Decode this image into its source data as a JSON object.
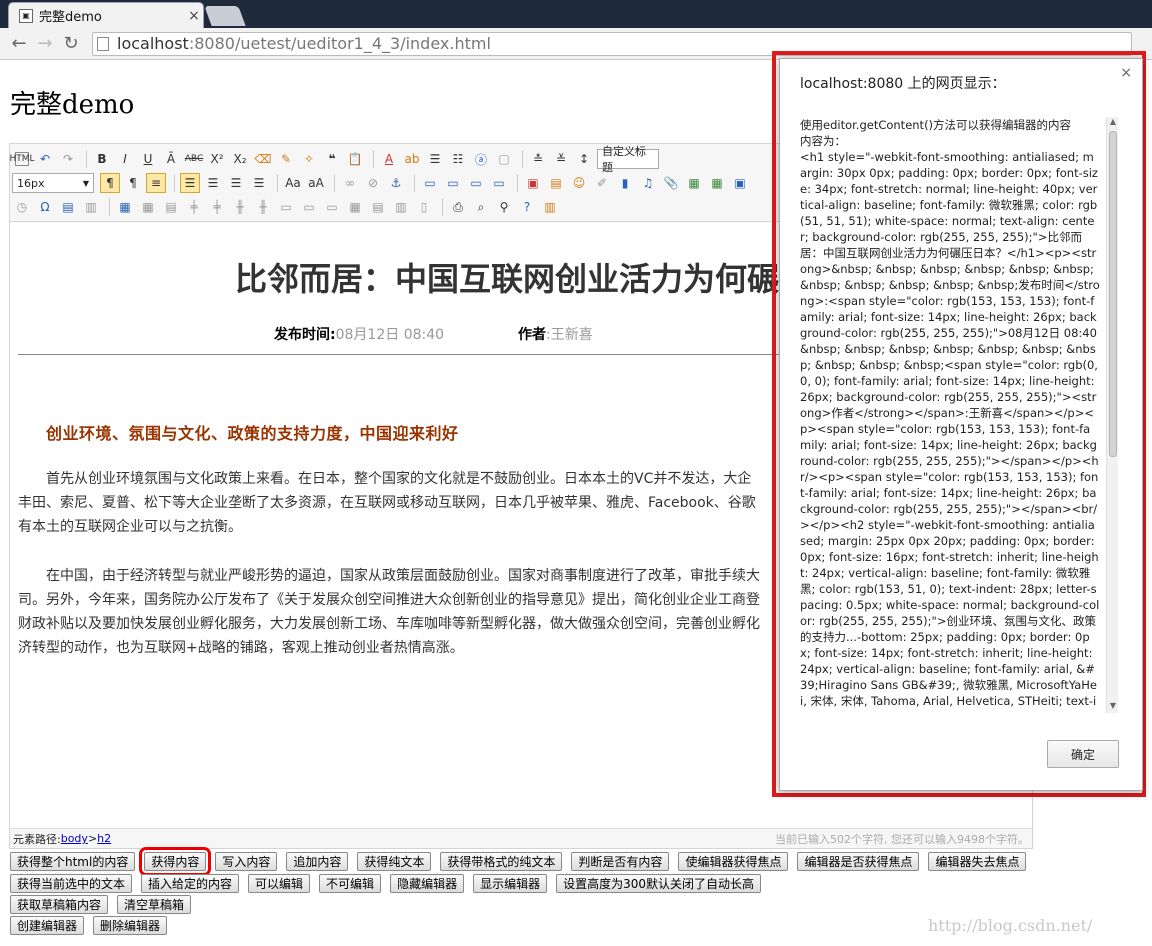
{
  "browser": {
    "tab_title": "完整demo",
    "tab_close": "×",
    "url_host": "localhost",
    "url_rest": ":8080/uetest/ueditor1_4_3/index.html"
  },
  "page": {
    "title": "完整demo"
  },
  "toolbar": {
    "font_size": "16px",
    "paragraph_format": "自定义标题"
  },
  "article": {
    "title": "比邻而居：中国互联网创业活力为何碾压",
    "time_label": "发布时间:",
    "time_value": "08月12日 08:40",
    "author_label": "作者",
    "author_value": ":王新喜",
    "heading": "创业环境、氛围与文化、政策的支持力度，中国迎来利好",
    "p1": [
      "首先从创业环境氛围与文化政策上来看。在日本，整个国家的文化就是不鼓励创业。日本本土的VC并不发达，大企",
      "丰田、索尼、夏普、松下等大企业垄断了太多资源，在互联网或移动互联网，日本几乎被苹果、雅虎、Facebook、谷歌",
      "有本土的互联网企业可以与之抗衡。"
    ],
    "p2": [
      "在中国，由于经济转型与就业严峻形势的逼迫，国家从政策层面鼓励创业。国家对商事制度进行了改革，审批手续大",
      "司。另外，今年来，国务院办公厅发布了《关于发展众创空间推进大众创新创业的指导意见》提出，简化创业企业工商登",
      "财政补贴以及要加快发展创业孵化服务，大力发展创新工场、车库咖啡等新型孵化器，做大做强众创空间，完善创业孵化",
      "济转型的动作，也为互联网+战略的铺路，客观上推动创业者热情高涨。"
    ]
  },
  "statusbar": {
    "path_label": "元素路径:",
    "path_body": "body",
    "path_sep": " > ",
    "path_h2": "h2",
    "count": "当前已输入502个字符, 您还可以输入9498个字符。"
  },
  "buttons": {
    "row1": [
      "获得整个html的内容",
      "获得内容",
      "写入内容",
      "追加内容",
      "获得纯文本",
      "获得带格式的纯文本",
      "判断是否有内容",
      "使编辑器获得焦点",
      "编辑器是否获得焦点",
      "编辑器失去焦点"
    ],
    "row2": [
      "获得当前选中的文本",
      "插入给定的内容",
      "可以编辑",
      "不可编辑",
      "隐藏编辑器",
      "显示编辑器",
      "设置高度为300默认关闭了自动长高"
    ],
    "row3": [
      "获取草稿箱内容",
      "清空草稿箱"
    ],
    "row4": [
      "创建编辑器",
      "删除编辑器"
    ]
  },
  "watermark": "http://blog.csdn.net/",
  "dialog": {
    "title": "localhost:8080 上的网页显示：",
    "close": "×",
    "ok": "确定",
    "body": "使用editor.getContent()方法可以获得编辑器的内容\n内容为：\n<h1 style=\"-webkit-font-smoothing: antialiased; margin: 30px 0px; padding: 0px; border: 0px; font-size: 34px; font-stretch: normal; line-height: 40px; vertical-align: baseline; font-family: 微软雅黑; color: rgb(51, 51, 51); white-space: normal; text-align: center; background-color: rgb(255, 255, 255);\">比邻而居：中国互联网创业活力为何碾压日本？</h1><p><strong>&nbsp; &nbsp; &nbsp; &nbsp; &nbsp; &nbsp; &nbsp; &nbsp; &nbsp; &nbsp; &nbsp;发布时间</strong>:<span style=\"color: rgb(153, 153, 153); font-family: arial; font-size: 14px; line-height: 26px; background-color: rgb(255, 255, 255);\">08月12日 08:40 &nbsp; &nbsp; &nbsp; &nbsp; &nbsp; &nbsp; &nbsp; &nbsp; &nbsp; &nbsp;<span style=\"color: rgb(0, 0, 0); font-family: arial; font-size: 14px; line-height: 26px; background-color: rgb(255, 255, 255);\"><strong>作者</strong></span>:王新喜</span></p><p><span style=\"color: rgb(153, 153, 153); font-family: arial; font-size: 14px; line-height: 26px; background-color: rgb(255, 255, 255);\"></span></p><hr/><p><span style=\"color: rgb(153, 153, 153); font-family: arial; font-size: 14px; line-height: 26px; background-color: rgb(255, 255, 255);\"></span><br/></p><h2 style=\"-webkit-font-smoothing: antialiased; margin: 25px 0px 20px; padding: 0px; border: 0px; font-size: 16px; font-stretch: inherit; line-height: 24px; vertical-align: baseline; font-family: 微软雅黑; color: rgb(153, 51, 0); text-indent: 28px; letter-spacing: 0.5px; white-space: normal; background-color: rgb(255, 255, 255);\">创业环境、氛围与文化、政策的支持力...-bottom: 25px; padding: 0px; border: 0px; font-size: 14px; font-stretch: inherit; line-height: 24px; vertical-align: baseline; font-family: arial, &#39;Hiragino Sans GB&#39;, 微软雅黑, MicrosoftYaHei, 宋体, 宋体, Tahoma, Arial, Helvetica, STHeiti; text-indent: 28px; letter-spacing:"
  }
}
